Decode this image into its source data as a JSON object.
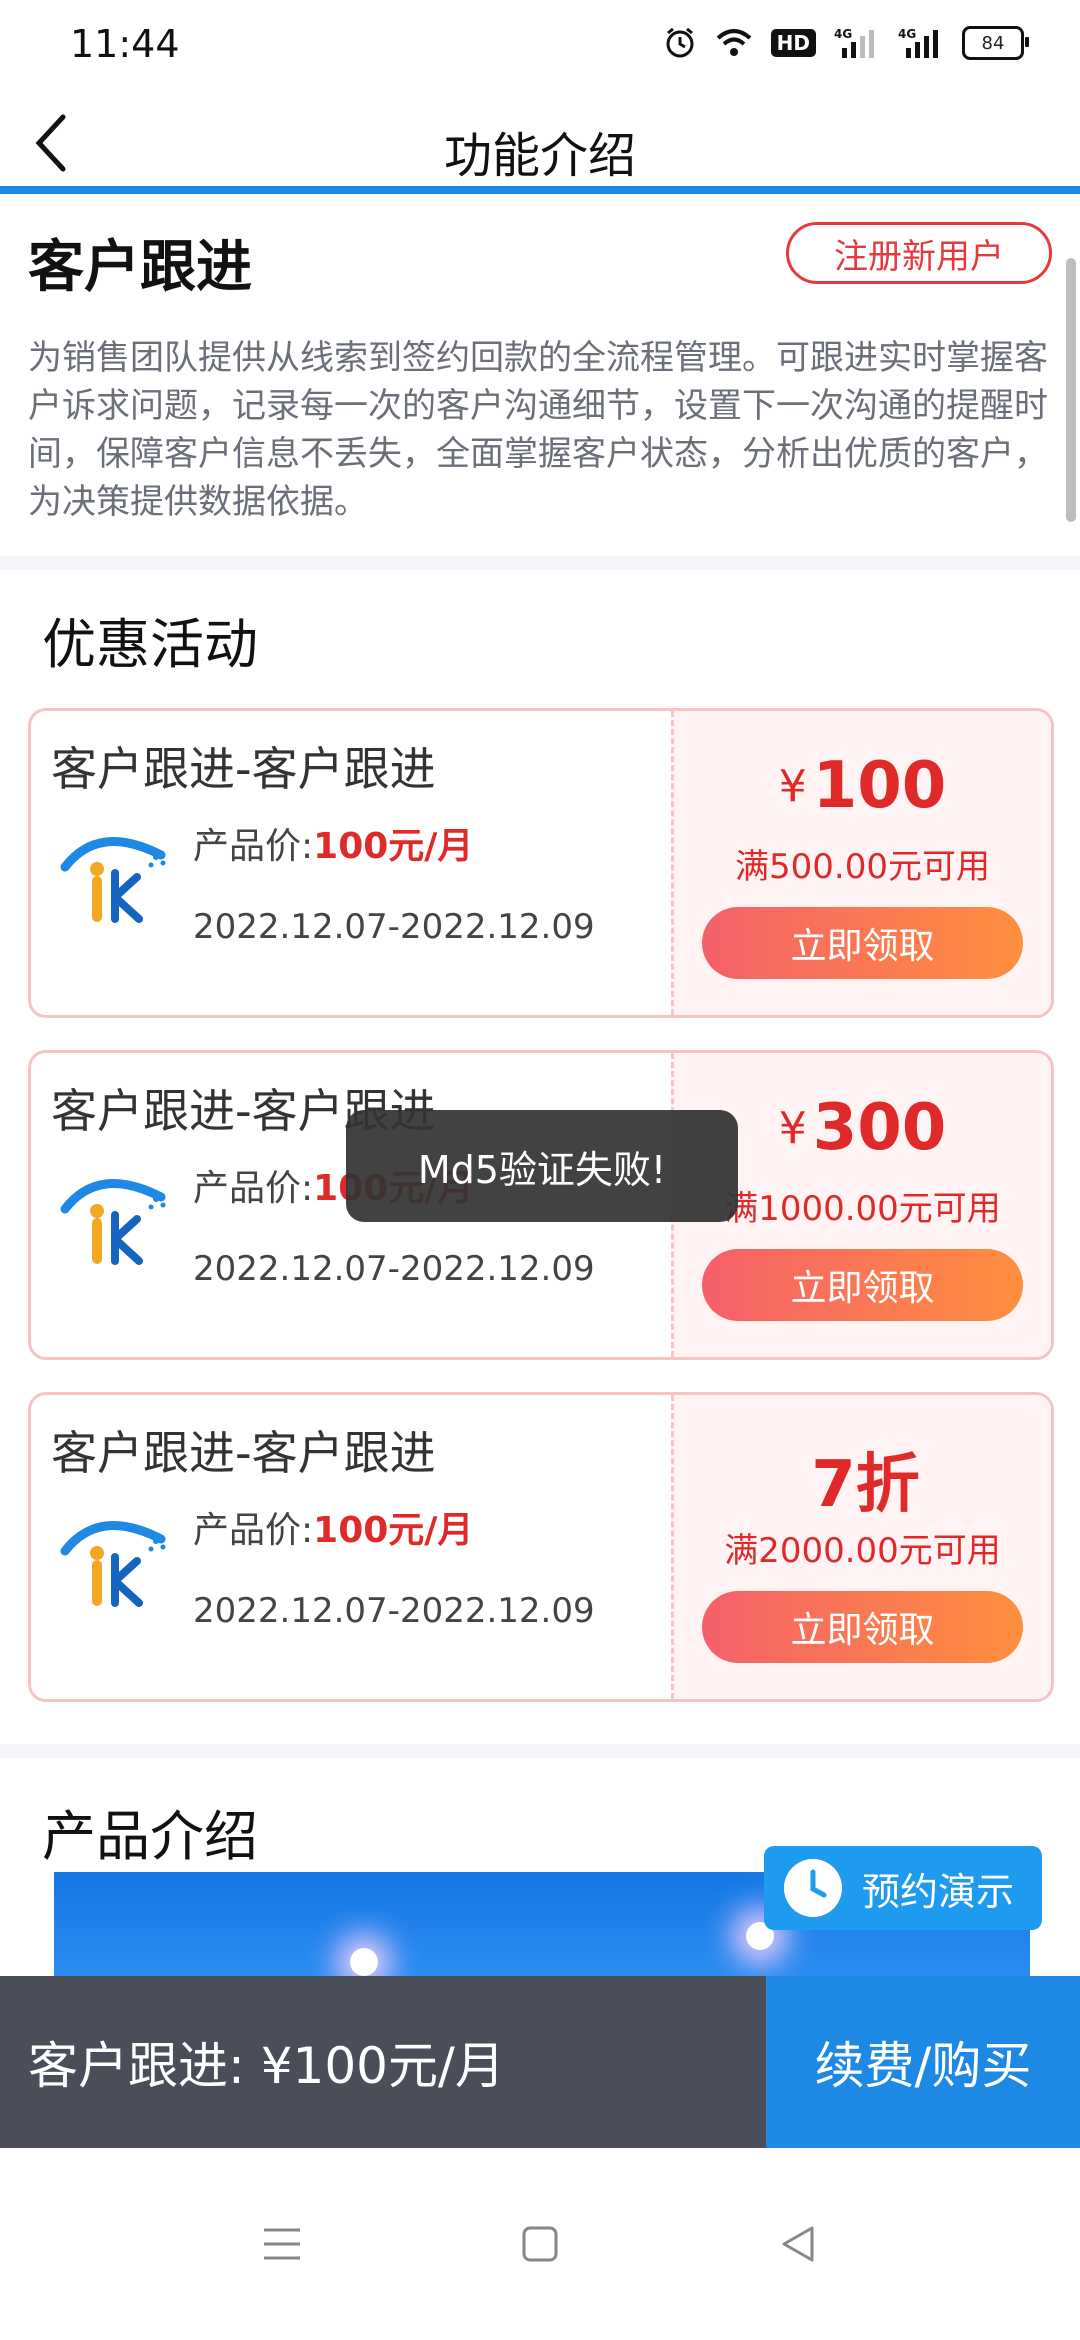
{
  "status_bar": {
    "time": "11:44",
    "hd_badge": "HD",
    "network_1": "4G",
    "network_2": "4G",
    "battery": "84"
  },
  "header": {
    "back_icon": "chevron-left-icon",
    "title": "功能介绍"
  },
  "intro": {
    "title": "客户跟进",
    "register_button": "注册新用户",
    "description": "为销售团队提供从线索到签约回款的全流程管理。可跟进实时掌握客户诉求问题，记录每一次的客户沟通细节，设置下一次沟通的提醒时间，保障客户信息不丢失，全面掌握客户状态，分析出优质的客户，为决策提供数据依据。"
  },
  "promotions": {
    "title": "优惠活动",
    "coupons": [
      {
        "name": "客户跟进-客户跟进",
        "price_label": "产品价:",
        "price_value": "100元/月",
        "dates": "2022.12.07-2022.12.09",
        "currency": "¥",
        "amount": "100",
        "condition": "满500.00元可用",
        "claim_button": "立即领取"
      },
      {
        "name": "客户跟进-客户跟进",
        "price_label": "产品价:",
        "price_value": "100元/月",
        "dates": "2022.12.07-2022.12.09",
        "currency": "¥",
        "amount": "300",
        "condition": "满1000.00元可用",
        "claim_button": "立即领取"
      },
      {
        "name": "客户跟进-客户跟进",
        "price_label": "产品价:",
        "price_value": "100元/月",
        "dates": "2022.12.07-2022.12.09",
        "currency": "",
        "amount": "7折",
        "condition": "满2000.00元可用",
        "claim_button": "立即领取"
      }
    ]
  },
  "toast": "Md5验证失败!",
  "product": {
    "title": "产品介绍"
  },
  "demo_button": "预约演示",
  "bottom_bar": {
    "summary": "客户跟进:  ¥100元/月",
    "buy_button": "续费/购买"
  },
  "colors": {
    "accent_blue": "#1e88e5",
    "price_red": "#e02a2a",
    "button_gradient_start": "#f4606a",
    "button_gradient_end": "#ff8f3e",
    "bottom_dark": "#4a4e59"
  }
}
